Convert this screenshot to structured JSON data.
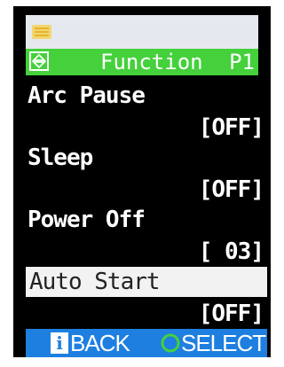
{
  "header": {
    "battery_icon": "battery-icon",
    "nav_icon": "up-down-arrows-icon"
  },
  "title_bar": {
    "title": "Function",
    "page": "P1",
    "color": "#44d13c"
  },
  "menu": {
    "items": [
      {
        "label": "Arc Pause",
        "value": "[OFF]",
        "selected": false
      },
      {
        "label": "Sleep",
        "value": "[OFF]",
        "selected": false
      },
      {
        "label": "Power Off",
        "value": "[ 03]",
        "selected": false
      },
      {
        "label": "Auto Start",
        "value": "[OFF]",
        "selected": true
      }
    ]
  },
  "footer": {
    "back_label": "BACK",
    "back_icon": "info-icon",
    "back_icon_glyph": "i",
    "select_label": "SELECT",
    "select_icon": "circle-ok-icon",
    "color": "#1e7fe0"
  }
}
